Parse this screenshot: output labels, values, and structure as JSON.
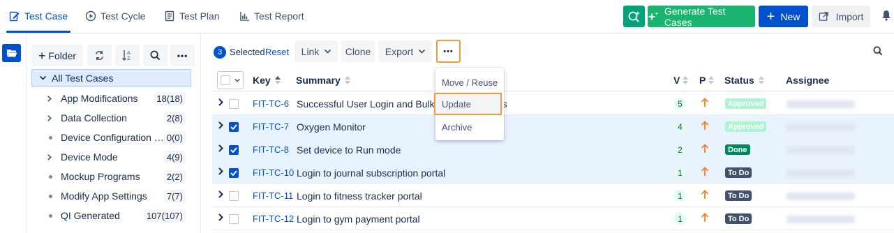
{
  "nav": {
    "tabs": [
      {
        "label": "Test Case",
        "icon": "edit-icon"
      },
      {
        "label": "Test Cycle",
        "icon": "play-circle-icon"
      },
      {
        "label": "Test Plan",
        "icon": "document-icon"
      },
      {
        "label": "Test Report",
        "icon": "bar-chart-icon"
      }
    ],
    "generate_label": "Generate Test Cases",
    "new_label": "New",
    "import_label": "Import"
  },
  "folders": {
    "add_label": "Folder",
    "root_label": "All Test Cases",
    "items": [
      {
        "label": "App Modifications",
        "count": "18(18)",
        "has_children": true
      },
      {
        "label": "Data Collection",
        "count": "2(8)",
        "has_children": true
      },
      {
        "label": "Device Configuration fo...",
        "count": "0(0)",
        "has_children": false
      },
      {
        "label": "Device Mode",
        "count": "4(9)",
        "has_children": true
      },
      {
        "label": "Mockup Programs",
        "count": "2(2)",
        "has_children": false
      },
      {
        "label": "Modify App Settings",
        "count": "7(7)",
        "has_children": false
      },
      {
        "label": "QI Generated",
        "count": "107(107)",
        "has_children": false
      }
    ]
  },
  "toolbar": {
    "selected_count": "3",
    "selected_label": "Selected",
    "reset_label": "Reset",
    "link_label": "Link",
    "clone_label": "Clone",
    "export_label": "Export"
  },
  "menu": {
    "items": [
      "Move / Reuse",
      "Update",
      "Archive"
    ],
    "highlighted": "Update"
  },
  "table": {
    "columns": {
      "key": "Key",
      "summary": "Summary",
      "version": "V",
      "priority": "P",
      "status": "Status",
      "assignee": "Assignee"
    },
    "rows": [
      {
        "key": "FIT-TC-6",
        "summary": "Successful User Login and Bulk Im",
        "summary_tail": "rs",
        "version": "5",
        "status": "Approved",
        "status_color": "#abf5d1",
        "checked": false
      },
      {
        "key": "FIT-TC-7",
        "summary": "Oxygen Monitor",
        "summary_tail": "",
        "version": "4",
        "status": "Approved",
        "status_color": "#abf5d1",
        "checked": true
      },
      {
        "key": "FIT-TC-8",
        "summary": "Set device to Run mode",
        "summary_tail": "",
        "version": "2",
        "status": "Done",
        "status_color": "#00875a",
        "checked": true
      },
      {
        "key": "FIT-TC-10",
        "summary": "Login to journal subscription portal",
        "summary_tail": "",
        "version": "1",
        "status": "To Do",
        "status_color": "#42526e",
        "checked": true
      },
      {
        "key": "FIT-TC-11",
        "summary": "Login to fitness tracker portal",
        "summary_tail": "",
        "version": "1",
        "status": "To Do",
        "status_color": "#42526e",
        "checked": false
      },
      {
        "key": "FIT-TC-12",
        "summary": "Login to gym payment portal",
        "summary_tail": "",
        "version": "1",
        "status": "To Do",
        "status_color": "#42526e",
        "checked": false
      }
    ]
  },
  "colors": {
    "accent": "#0052cc",
    "highlight": "#f39a3a",
    "generate": "#19b46f",
    "priority_high": "#ff7c1f"
  }
}
